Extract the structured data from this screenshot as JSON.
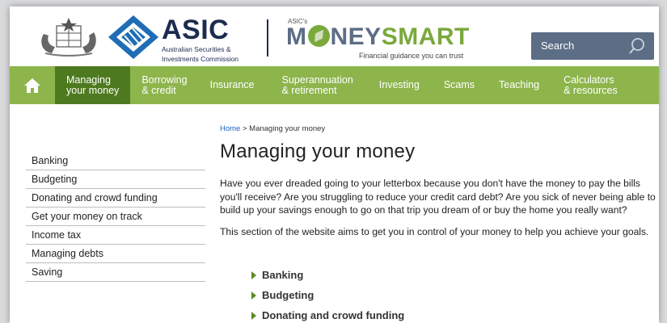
{
  "header": {
    "asic_name": "ASIC",
    "asic_sub1": "Australian Securities &",
    "asic_sub2": "Investments Commission",
    "ms_prefix": "ASIC's",
    "ms_money": "M",
    "ms_money_rest": "NEY",
    "ms_smart": "SMART",
    "ms_tagline": "Financial guidance you can trust",
    "search_label": "Search"
  },
  "nav": {
    "items": [
      {
        "line1": "Managing",
        "line2": "your money"
      },
      {
        "line1": "Borrowing",
        "line2": "& credit"
      },
      {
        "line1": "Insurance",
        "line2": ""
      },
      {
        "line1": "Superannuation",
        "line2": "& retirement"
      },
      {
        "line1": "Investing",
        "line2": ""
      },
      {
        "line1": "Scams",
        "line2": ""
      },
      {
        "line1": "Teaching",
        "line2": ""
      },
      {
        "line1": "Calculators",
        "line2": "& resources"
      }
    ]
  },
  "sidebar": {
    "items": [
      "Banking",
      "Budgeting",
      "Donating and crowd funding",
      "Get your money on track",
      "Income tax",
      "Managing debts",
      "Saving"
    ]
  },
  "breadcrumb": {
    "home": "Home",
    "separator": " > ",
    "current": "Managing your money"
  },
  "main": {
    "title": "Managing your money",
    "para1": "Have you ever dreaded going to your letterbox because you don't have the money to pay the bills you'll receive? Are you struggling to reduce your credit card debt? Are you sick of never being able to build up your savings enough to go on that trip you dream of or buy the home you really want?",
    "para2": "This section of the website aims to get you in control of your money to help you achieve your goals.",
    "links": [
      "Banking",
      "Budgeting",
      "Donating and crowd funding"
    ]
  },
  "colors": {
    "nav_green": "#8db54c",
    "nav_active": "#4e7a1f",
    "asic_navy": "#1d2b4f",
    "search_bg": "#5c6d86",
    "link_blue": "#1e61c0"
  }
}
